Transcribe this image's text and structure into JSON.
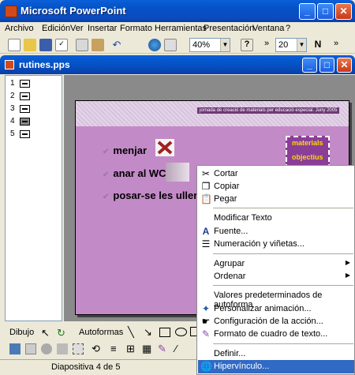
{
  "app": {
    "title": "Microsoft PowerPoint"
  },
  "menus": [
    "Archivo",
    "Edición",
    "Ver",
    "Insertar",
    "Formato",
    "Herramientas",
    "Presentación",
    "Ventana",
    "?"
  ],
  "toolbar": {
    "zoom": "40%",
    "font_size": "20"
  },
  "document": {
    "title": "rutines.pps"
  },
  "outline": {
    "slides": [
      "1",
      "2",
      "3",
      "4",
      "5"
    ]
  },
  "slide": {
    "header_text": "jornada de creació de materials per educació especial. Juny 2005",
    "bullets": [
      "menjar",
      "anar al WC",
      "posar-se les ullere"
    ],
    "object_text": [
      "materials",
      "objectius"
    ]
  },
  "drawing": {
    "dibujo_label": "Dibujo",
    "autoformas_label": "Autoformas"
  },
  "status": {
    "slide_info": "Diapositiva 4 de 5"
  },
  "context_menu": {
    "items": [
      {
        "label": "Cortar",
        "icon": "scissors-icon"
      },
      {
        "label": "Copiar",
        "icon": "copy-icon"
      },
      {
        "label": "Pegar",
        "icon": "paste-icon"
      },
      {
        "label": "Modificar Texto",
        "icon": ""
      },
      {
        "label": "Fuente...",
        "icon": "font-icon"
      },
      {
        "label": "Numeración y viñetas...",
        "icon": "bullets-icon"
      },
      {
        "label": "Agrupar",
        "icon": ""
      },
      {
        "label": "Ordenar",
        "icon": ""
      },
      {
        "label": "Valores predeterminados de autoforma",
        "icon": ""
      },
      {
        "label": "Personalizar animación...",
        "icon": "animation-icon"
      },
      {
        "label": "Configuración de la acción...",
        "icon": "action-icon"
      },
      {
        "label": "Formato de cuadro de texto...",
        "icon": "textbox-format-icon"
      },
      {
        "label": "Definir...",
        "icon": ""
      },
      {
        "label": "Hipervínculo...",
        "icon": "hyperlink-icon"
      }
    ]
  }
}
